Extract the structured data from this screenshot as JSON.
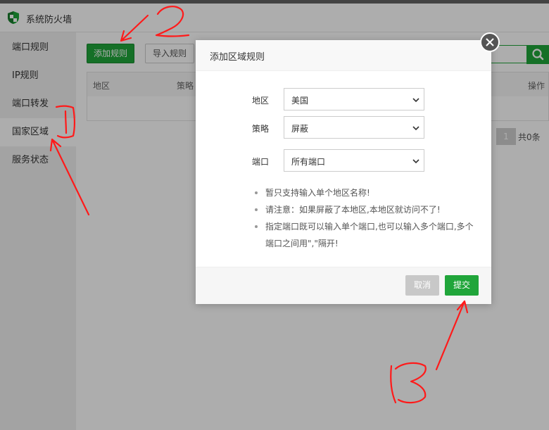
{
  "app": {
    "title": "系统防火墙"
  },
  "sidebar": {
    "items": [
      {
        "label": "端口规则"
      },
      {
        "label": "IP规则"
      },
      {
        "label": "端口转发"
      },
      {
        "label": "国家区域"
      },
      {
        "label": "服务状态"
      }
    ],
    "active_index": 3
  },
  "toolbar": {
    "add_label": "添加规则",
    "import_label": "导入规则"
  },
  "table": {
    "columns": [
      "地区",
      "策略",
      "操作"
    ]
  },
  "pagination": {
    "current": "1",
    "total": "共0条"
  },
  "dialog": {
    "title": "添加区域规则",
    "fields": {
      "region": {
        "label": "地区",
        "value": "美国"
      },
      "strategy": {
        "label": "策略",
        "value": "屏蔽"
      },
      "port": {
        "label": "端口",
        "value": "所有端口"
      }
    },
    "tips": [
      "暂只支持输入单个地区名称!",
      "请注意：如果屏蔽了本地区,本地区就访问不了!",
      "指定端口既可以输入单个端口,也可以输入多个端口,多个端口之间用\",\"隔开!"
    ],
    "cancel_label": "取消",
    "submit_label": "提交"
  },
  "colors": {
    "accent": "#20a53a",
    "annotation": "#ff1a1a"
  },
  "icons": {
    "logo": "shield-icon",
    "search": "search-icon",
    "close": "close-icon",
    "select": "chevron-down-icon"
  }
}
